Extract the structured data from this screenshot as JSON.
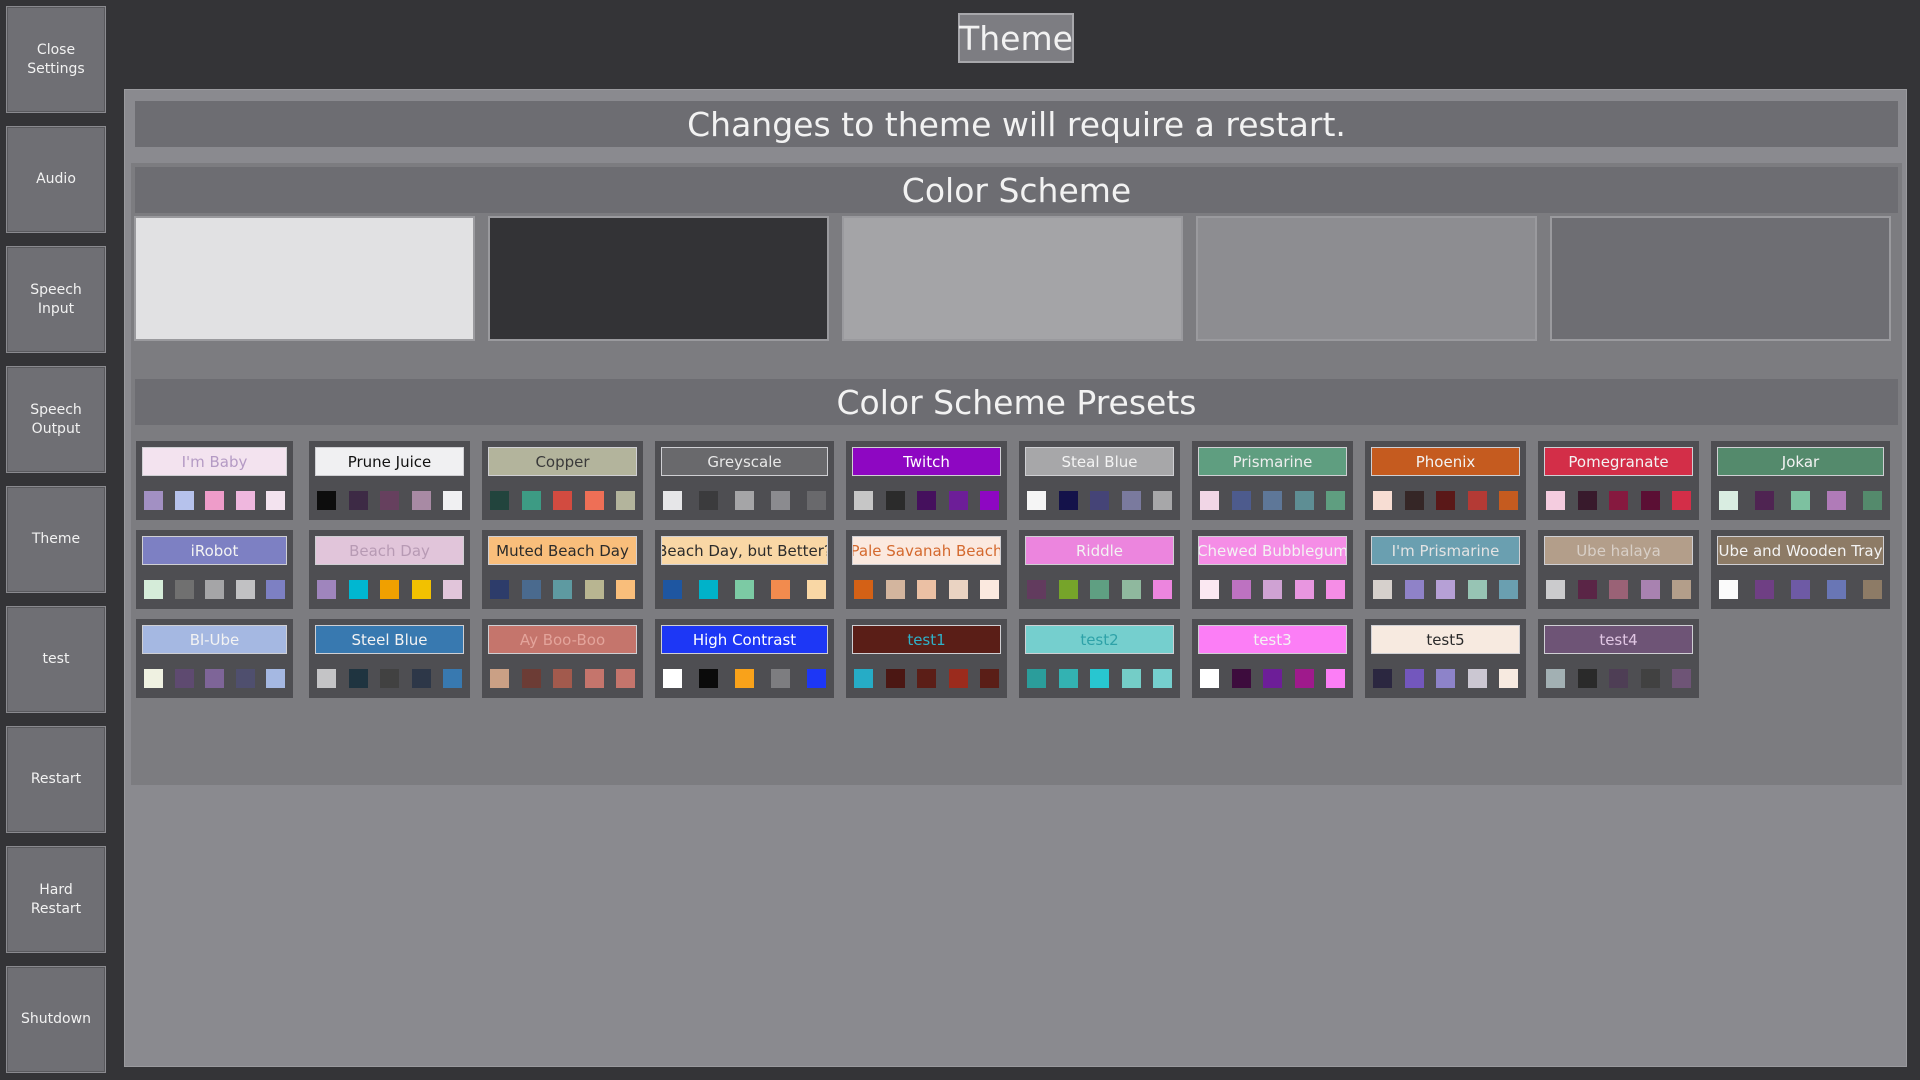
{
  "sidebar": {
    "items": [
      {
        "label": "Close\nSettings"
      },
      {
        "label": "Audio"
      },
      {
        "label": "Speech\nInput"
      },
      {
        "label": "Speech\nOutput"
      },
      {
        "label": "Theme"
      },
      {
        "label": "test"
      },
      {
        "label": "Restart"
      },
      {
        "label": "Hard\nRestart"
      },
      {
        "label": "Shutdown"
      }
    ]
  },
  "header": {
    "title": "Theme"
  },
  "notice": "Changes to theme will require a restart.",
  "color_scheme": {
    "title": "Color Scheme",
    "swatches": [
      "#e1e1e3",
      "#333336",
      "#a4a4a7",
      "#8d8d91",
      "#6e6e73"
    ]
  },
  "presets": {
    "title": "Color Scheme Presets",
    "rows": [
      [
        {
          "name": "I'm Baby",
          "bg": "#f3e3ef",
          "fg": "#b49ac4",
          "colors": [
            "#a290c3",
            "#b6c2ec",
            "#ee9cc9",
            "#efb7de",
            "#f3e3ef"
          ]
        },
        {
          "name": "Prune Juice",
          "bg": "#f0f0f2",
          "fg": "#111111",
          "colors": [
            "#0d0d0d",
            "#3d2a45",
            "#66405e",
            "#a88aa4",
            "#f0f0f2"
          ]
        },
        {
          "name": "Copper",
          "bg": "#b3b49c",
          "fg": "#3a3a3a",
          "colors": [
            "#22443d",
            "#3d9b84",
            "#d24b40",
            "#ee6f56",
            "#b3b49c"
          ]
        },
        {
          "name": "Greyscale",
          "bg": "#69696c",
          "fg": "#e8e8e8",
          "colors": [
            "#e6e6e8",
            "#3b3b3d",
            "#a5a5a7",
            "#8b8b8f",
            "#69696c"
          ]
        },
        {
          "name": "Twitch",
          "bg": "#8e07c2",
          "fg": "#ffffff",
          "colors": [
            "#c6c6c6",
            "#2b2b2b",
            "#45105d",
            "#6d1e98",
            "#8e07c2"
          ]
        },
        {
          "name": "Steal Blue",
          "bg": "#a7a7a9",
          "fg": "#f4f4f4",
          "colors": [
            "#f5f5f5",
            "#14124a",
            "#454477",
            "#7a7a9e",
            "#a7a7a9"
          ]
        },
        {
          "name": "Prismarine",
          "bg": "#5f9e80",
          "fg": "#eeeeee",
          "colors": [
            "#f1d6e6",
            "#4d5b8d",
            "#5e7798",
            "#5e8e94",
            "#5f9e80"
          ]
        },
        {
          "name": "Phoenix",
          "bg": "#c55b1f",
          "fg": "#f3f3f3",
          "colors": [
            "#f7ddd3",
            "#352626",
            "#5a1818",
            "#b43a35",
            "#c55b1f"
          ]
        },
        {
          "name": "Pomegranate",
          "bg": "#d32e48",
          "fg": "#f3f3f3",
          "colors": [
            "#f4ccdf",
            "#381a2c",
            "#86193f",
            "#5b0f34",
            "#d32e48"
          ]
        },
        {
          "name": "Jokar",
          "bg": "#548a6c",
          "fg": "#f3f3f3",
          "colors": [
            "#d9ede1",
            "#4f2452",
            "#7dc1a0",
            "#b07bb8",
            "#548a6c"
          ]
        }
      ],
      [
        {
          "name": "iRobot",
          "bg": "#7d80c3",
          "fg": "#f3f3f3",
          "colors": [
            "#d5ecd9",
            "#707070",
            "#a5a5a7",
            "#c1c1c3",
            "#7d80c3"
          ]
        },
        {
          "name": "Beach Day",
          "bg": "#e1c5da",
          "fg": "#b79ab4",
          "colors": [
            "#9f85bd",
            "#00b7d1",
            "#f0a000",
            "#f2c100",
            "#e1c5da"
          ]
        },
        {
          "name": "Muted Beach Day",
          "bg": "#f9be7b",
          "fg": "#2b2b2b",
          "colors": [
            "#2d3c6a",
            "#4a6a8e",
            "#5e9aa1",
            "#b8b591",
            "#f9be7b"
          ]
        },
        {
          "name": "Beach Day, but Better?",
          "bg": "#f9d7a5",
          "fg": "#2b2b2b",
          "colors": [
            "#1e56a1",
            "#00b2c9",
            "#7ccaa4",
            "#f28b4e",
            "#f9d7a5"
          ]
        },
        {
          "name": "Pale Savanah Beach",
          "bg": "#fbe9df",
          "fg": "#d4692e",
          "colors": [
            "#d46116",
            "#d3b59e",
            "#ebc0a4",
            "#ead3c2",
            "#fbe9df"
          ]
        },
        {
          "name": "Riddle",
          "bg": "#ec85de",
          "fg": "#f3f3f3",
          "colors": [
            "#623b5e",
            "#76a42a",
            "#5f9f82",
            "#8fb89e",
            "#ec85de"
          ]
        },
        {
          "name": "Chewed Bubblegum",
          "bg": "#f58de6",
          "fg": "#f3f3f3",
          "colors": [
            "#fbe8f2",
            "#bd72c1",
            "#cfa2d3",
            "#e896e0",
            "#f58de6"
          ]
        },
        {
          "name": "I'm Prismarine",
          "bg": "#6a9fb0",
          "fg": "#e3e3e3",
          "colors": [
            "#d6d0cc",
            "#8f82c8",
            "#b6a0d6",
            "#97c4b4",
            "#6a9fb0"
          ]
        },
        {
          "name": "Ube halaya",
          "bg": "#b39e8a",
          "fg": "#d8cfc7",
          "colors": [
            "#cbcbcd",
            "#5a2546",
            "#9a6276",
            "#a882b0",
            "#b39e8a"
          ]
        },
        {
          "name": "Ube and Wooden Tray",
          "bg": "#8d7b66",
          "fg": "#f3f3f3",
          "colors": [
            "#fbfbfb",
            "#6f3f84",
            "#6e5aa5",
            "#6976b5",
            "#8d7b66"
          ]
        }
      ],
      [
        {
          "name": "Bl-Ube",
          "bg": "#a5b8e2",
          "fg": "#f3f3f3",
          "colors": [
            "#eff1e1",
            "#5e4a70",
            "#7e6598",
            "#4f4f6e",
            "#a5b8e2"
          ]
        },
        {
          "name": "Steel Blue",
          "bg": "#3879b0",
          "fg": "#f3f3f3",
          "colors": [
            "#c4c4c6",
            "#1f3440",
            "#414141",
            "#2d3748",
            "#3879b0"
          ]
        },
        {
          "name": "Ay Boo-Boo",
          "bg": "#c5756c",
          "fg": "#e3a49b",
          "colors": [
            "#caa085",
            "#6c3c35",
            "#a25a4d",
            "#c5756c",
            "#c5756c"
          ]
        },
        {
          "name": "High Contrast",
          "bg": "#1d37f6",
          "fg": "#ffffff",
          "colors": [
            "#ffffff",
            "#0b0b0b",
            "#f9a21a",
            "#7d7d80",
            "#1d37f6"
          ]
        },
        {
          "name": "test1",
          "bg": "#5a1e17",
          "fg": "#2fb0c7",
          "colors": [
            "#26acc6",
            "#4b1713",
            "#5b1e17",
            "#9b2b1d",
            "#5a1e17"
          ]
        },
        {
          "name": "test2",
          "bg": "#75cfce",
          "fg": "#2ea2a8",
          "colors": [
            "#2b9d9b",
            "#33b2b2",
            "#28c6d0",
            "#74cdc7",
            "#75cfce"
          ]
        },
        {
          "name": "test3",
          "bg": "#fc7ef6",
          "fg": "#f3f3f3",
          "colors": [
            "#ffffff",
            "#3d0c3d",
            "#6d1e98",
            "#9f1a8c",
            "#fc7ef6"
          ]
        },
        {
          "name": "test5",
          "bg": "#f7eae0",
          "fg": "#2b2b2b",
          "colors": [
            "#2b2740",
            "#7357bd",
            "#8d83c9",
            "#cbc7d2",
            "#f7eae0"
          ]
        },
        {
          "name": "test4",
          "bg": "#6e5476",
          "fg": "#e0c6e3",
          "colors": [
            "#a2b0b3",
            "#2a2a2a",
            "#4e3e55",
            "#414141",
            "#6e5476"
          ]
        }
      ]
    ]
  }
}
